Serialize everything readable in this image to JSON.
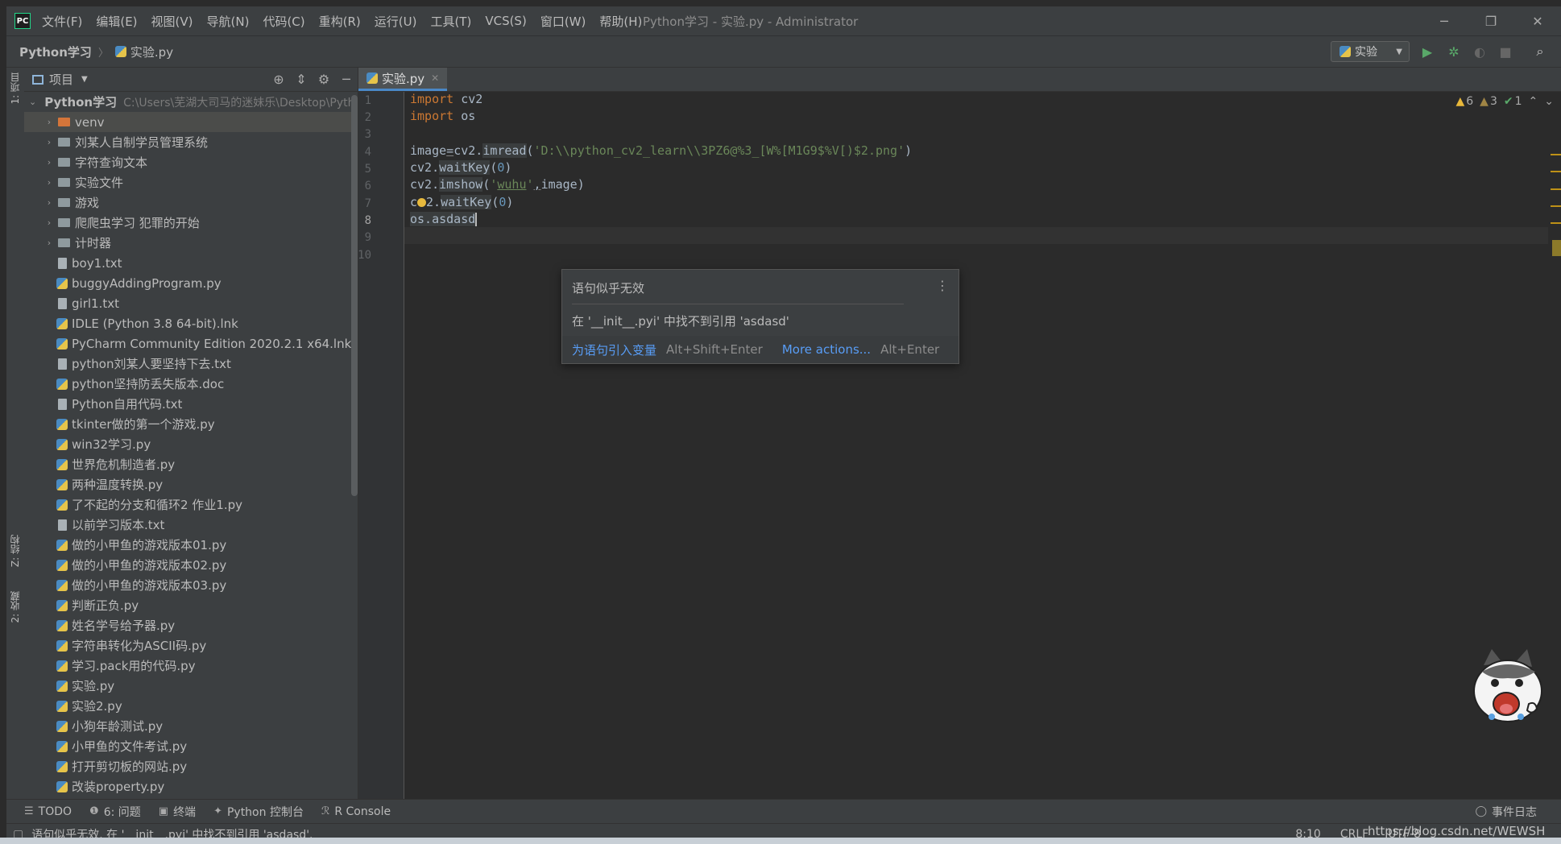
{
  "menu": {
    "items": [
      "文件(F)",
      "编辑(E)",
      "视图(V)",
      "导航(N)",
      "代码(C)",
      "重构(R)",
      "运行(U)",
      "工具(T)",
      "VCS(S)",
      "窗口(W)",
      "帮助(H)"
    ],
    "window_title": "Python学习 - 实验.py - Administrator"
  },
  "navbar": {
    "root": "Python学习",
    "file": "实验.py",
    "run_config": "实验"
  },
  "left_stripe": {
    "project": "1: 项目",
    "structure": "Z: 结构",
    "favorites": "2: 收藏"
  },
  "project_panel": {
    "title": "项目",
    "root_name": "Python学习",
    "root_path": "C:\\Users\\芜湖大司马的迷妹乐\\Desktop\\Python学",
    "folders": [
      "venv",
      "刘某人自制学员管理系统",
      "字符查询文本",
      "实验文件",
      "游戏",
      "爬爬虫学习 犯罪的开始",
      "计时器"
    ],
    "files": [
      {
        "name": "boy1.txt",
        "type": "txt"
      },
      {
        "name": "buggyAddingProgram.py",
        "type": "py"
      },
      {
        "name": "girl1.txt",
        "type": "txt"
      },
      {
        "name": "IDLE (Python 3.8 64-bit).lnk",
        "type": "py"
      },
      {
        "name": "PyCharm Community Edition 2020.2.1 x64.lnk",
        "type": "py"
      },
      {
        "name": "python刘某人要坚持下去.txt",
        "type": "txt"
      },
      {
        "name": "python坚持防丢失版本.doc",
        "type": "py"
      },
      {
        "name": "Python自用代码.txt",
        "type": "txt"
      },
      {
        "name": "tkinter做的第一个游戏.py",
        "type": "py"
      },
      {
        "name": "win32学习.py",
        "type": "py"
      },
      {
        "name": "世界危机制造者.py",
        "type": "py"
      },
      {
        "name": "两种温度转换.py",
        "type": "py"
      },
      {
        "name": "了不起的分支和循环2 作业1.py",
        "type": "py"
      },
      {
        "name": "以前学习版本.txt",
        "type": "txt"
      },
      {
        "name": "做的小甲鱼的游戏版本01.py",
        "type": "py"
      },
      {
        "name": "做的小甲鱼的游戏版本02.py",
        "type": "py"
      },
      {
        "name": "做的小甲鱼的游戏版本03.py",
        "type": "py"
      },
      {
        "name": "判断正负.py",
        "type": "py"
      },
      {
        "name": "姓名学号给予器.py",
        "type": "py"
      },
      {
        "name": "字符串转化为ASCII码.py",
        "type": "py"
      },
      {
        "name": "学习.pack用的代码.py",
        "type": "py"
      },
      {
        "name": "实验.py",
        "type": "py"
      },
      {
        "name": "实验2.py",
        "type": "py"
      },
      {
        "name": "小狗年龄测试.py",
        "type": "py"
      },
      {
        "name": "小甲鱼的文件考试.py",
        "type": "py"
      },
      {
        "name": "打开剪切板的网站.py",
        "type": "py"
      },
      {
        "name": "改装property.py",
        "type": "py"
      }
    ]
  },
  "editor": {
    "tab": "实验.py",
    "line_numbers": [
      "1",
      "2",
      "3",
      "4",
      "5",
      "6",
      "7",
      "8",
      "9",
      "10"
    ],
    "code": {
      "l1_kw": "import",
      "l1_rest": " cv2",
      "l2_kw": "import",
      "l2_rest": " os",
      "l4_a": "image",
      "l4_eq": "=",
      "l4_b": "cv2.",
      "l4_fn": "imread",
      "l4_c": "(",
      "l4_str": "'D:\\\\python_cv2_learn\\\\3PZ6@%3_[W%[M1G9$%V[)$2.png'",
      "l4_d": ")",
      "l5_a": "cv2.",
      "l5_fn": "waitKey",
      "l5_b": "(",
      "l5_num": "0",
      "l5_c": ")",
      "l6_a": "cv2.",
      "l6_fn": "imshow",
      "l6_b": "(",
      "l6_str1": "'",
      "l6_str2": "wuhu",
      "l6_str3": "'",
      "l6_c": ",",
      "l6_d": "image)",
      "l7_a": "c",
      "l7_b": "2.",
      "l7_fn": "waitKey",
      "l7_c": "(",
      "l7_num": "0",
      "l7_d": ")",
      "l8": "os.asdasd"
    },
    "inspections": {
      "warnings": "6",
      "weak_warnings": "3",
      "ok": "1"
    }
  },
  "popup": {
    "title": "语句似乎无效",
    "description": "在 '__init__.pyi' 中找不到引用 'asdasd'",
    "action1": "为语句引入变量",
    "action1_key": "Alt+Shift+Enter",
    "action2": "More actions...",
    "action2_key": "Alt+Enter"
  },
  "bottom_tools": {
    "todo": "TODO",
    "problems": "6: 问题",
    "terminal": "终端",
    "python_console": "Python 控制台",
    "r_console": "R Console",
    "event_log": "事件日志"
  },
  "status": {
    "message": "语句似乎无效. 在 '__init__.pyi' 中找不到引用 'asdasd'.",
    "position": "8:10",
    "line_sep": "CRLF",
    "encoding": "UTF-8",
    "watermark": "https://blog.csdn.net/WEWSH"
  }
}
